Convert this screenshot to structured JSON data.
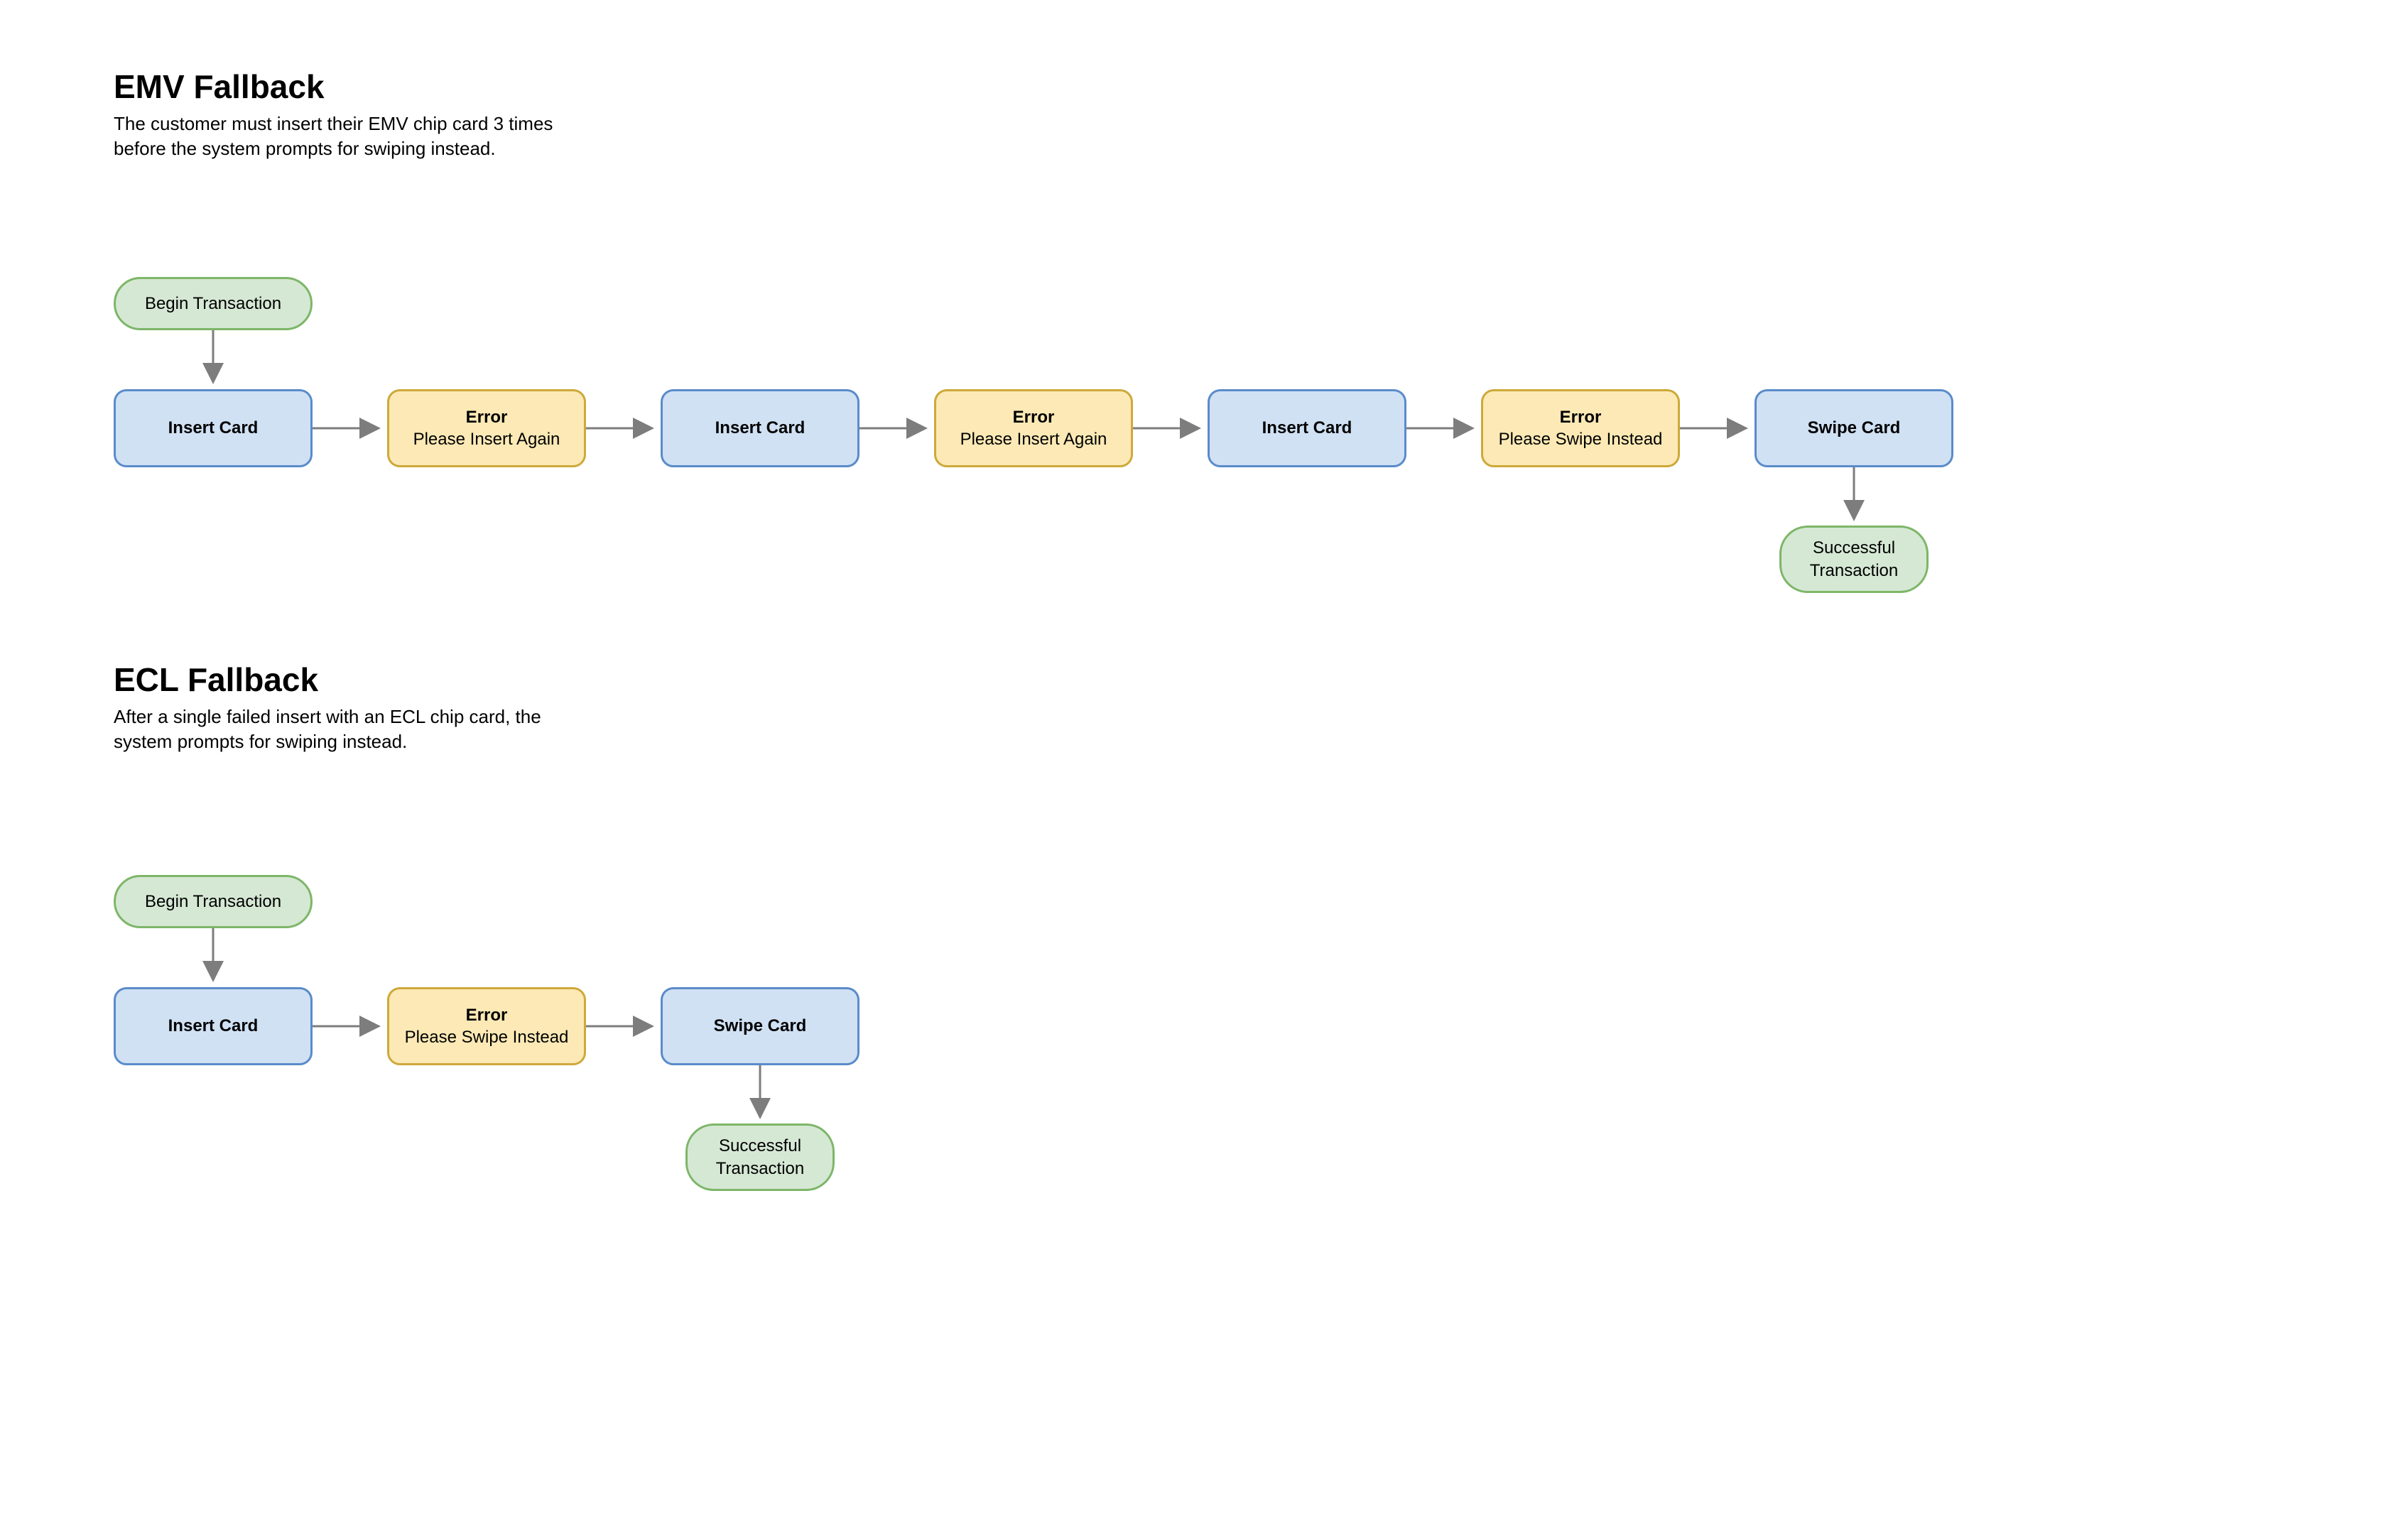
{
  "emv": {
    "title": "EMV Fallback",
    "desc": "The customer must insert their EMV chip card 3 times before the system prompts for swiping instead.",
    "begin": "Begin Transaction",
    "insert1": "Insert Card",
    "error1_title": "Error",
    "error1_sub": "Please Insert Again",
    "insert2": "Insert Card",
    "error2_title": "Error",
    "error2_sub": "Please Insert Again",
    "insert3": "Insert Card",
    "error3_title": "Error",
    "error3_sub": "Please Swipe Instead",
    "swipe": "Swipe Card",
    "success": "Successful Transaction"
  },
  "ecl": {
    "title": "ECL Fallback",
    "desc": "After a single failed insert with an ECL chip card, the system prompts for swiping instead.",
    "begin": "Begin Transaction",
    "insert1": "Insert Card",
    "error1_title": "Error",
    "error1_sub": "Please Swipe Instead",
    "swipe": "Swipe Card",
    "success": "Successful Transaction"
  },
  "colors": {
    "terminal_fill": "#d5e8d4",
    "terminal_stroke": "#7db668",
    "process_fill": "#d0e1f4",
    "process_stroke": "#5a8bc9",
    "error_fill": "#fce9b5",
    "error_stroke": "#cda93a",
    "arrow": "#7d7d7d"
  }
}
